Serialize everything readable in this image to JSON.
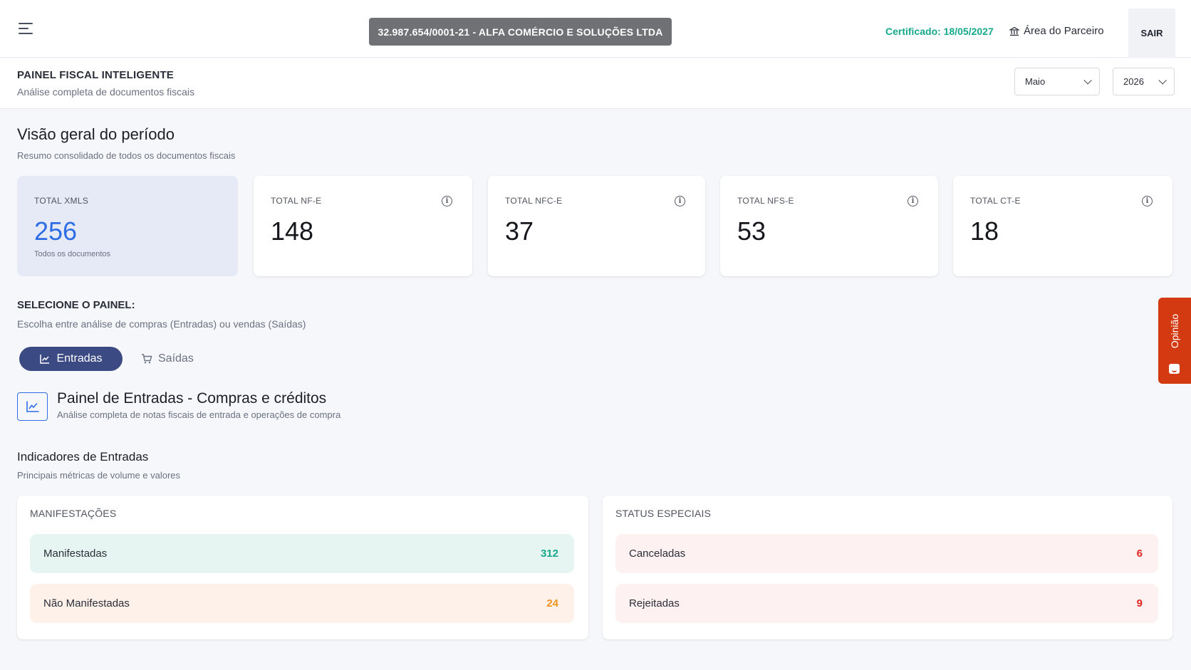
{
  "topbar": {
    "company": "32.987.654/0001-21 - ALFA COMÉRCIO E SOLUÇÕES LTDA",
    "certificate": "Certificado: 18/05/2027",
    "partner_area": "Área do Parceiro",
    "logout": "SAIR"
  },
  "header": {
    "title": "PAINEL FISCAL INTELIGENTE",
    "subtitle": "Análise completa de documentos fiscais",
    "month": "Maio",
    "year": "2026"
  },
  "overview": {
    "title": "Visão geral do período",
    "subtitle": "Resumo consolidado de todos os documentos fiscais",
    "cards": [
      {
        "label": "TOTAL XMLS",
        "value": "256",
        "note": "Todos os documentos"
      },
      {
        "label": "TOTAL NF-E",
        "value": "148"
      },
      {
        "label": "TOTAL NFC-E",
        "value": "37"
      },
      {
        "label": "TOTAL NFS-E",
        "value": "53"
      },
      {
        "label": "TOTAL CT-E",
        "value": "18"
      }
    ]
  },
  "panel_select": {
    "title": "SELECIONE O PAINEL:",
    "subtitle": "Escolha entre análise de compras (Entradas) ou vendas (Saídas)",
    "tabs": [
      "Entradas",
      "Saídas"
    ]
  },
  "panel": {
    "title": "Painel de Entradas - Compras e créditos",
    "subtitle": "Análise completa de notas fiscais de entrada e operações de compra"
  },
  "indicators": {
    "title": "Indicadores de Entradas",
    "subtitle": "Principais métricas de volume e valores",
    "manifestacoes": {
      "heading": "MANIFESTAÇÕES",
      "rows": [
        {
          "label": "Manifestadas",
          "value": "312"
        },
        {
          "label": "Não Manifestadas",
          "value": "24"
        }
      ]
    },
    "status": {
      "heading": "STATUS ESPECIAIS",
      "rows": [
        {
          "label": "Canceladas",
          "value": "6"
        },
        {
          "label": "Rejeitadas",
          "value": "9"
        }
      ]
    }
  },
  "feedback": {
    "label": "Opinião"
  },
  "colors": {
    "accent": "#2f6de6",
    "nav_active": "#3b4a82",
    "success": "#16a88a",
    "warning": "#f0941c",
    "danger": "#e0261f",
    "feedback": "#d33a12"
  }
}
